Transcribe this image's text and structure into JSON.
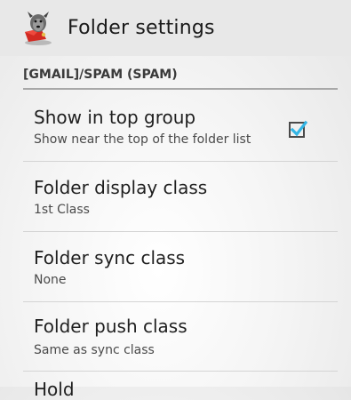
{
  "action_bar": {
    "title": "Folder settings",
    "app_icon": "k9-dog-icon"
  },
  "category": {
    "label": "[GMAIL]/SPAM (SPAM)"
  },
  "preferences": [
    {
      "title": "Show in top group",
      "summary": "Show near the top of the folder list",
      "checked": true
    },
    {
      "title": "Folder display class",
      "summary": "1st Class"
    },
    {
      "title": "Folder sync class",
      "summary": "None"
    },
    {
      "title": "Folder push class",
      "summary": "Same as sync class"
    }
  ],
  "partial_item": {
    "title": "Hold"
  },
  "colors": {
    "checkbox_check": "#33b5e5",
    "action_bar_bg": "#e8e8e8"
  }
}
